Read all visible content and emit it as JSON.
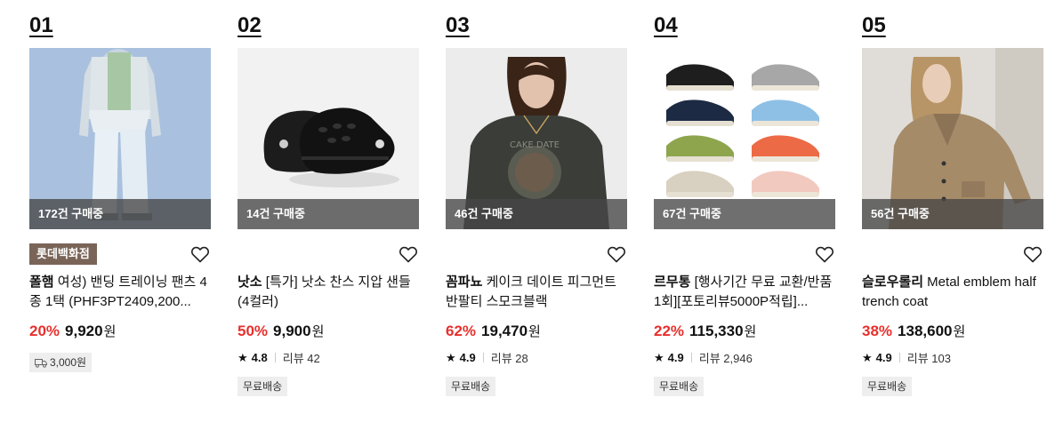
{
  "products": [
    {
      "rank": "01",
      "buying": "172건 구매중",
      "badge": "롯데백화점",
      "brand": "폴햄",
      "name": " 여성) 밴딩 트레이닝 팬츠 4종 1택 (PHF3PT2409,200...",
      "discount": "20%",
      "price": "9,920",
      "won": "원",
      "shipping_fee": "3,000원"
    },
    {
      "rank": "02",
      "buying": "14건 구매중",
      "brand": "낫소",
      "name": " [특가] 낫소 찬스 지압 샌들(4컬러)",
      "discount": "50%",
      "price": "9,900",
      "won": "원",
      "rating": "4.8",
      "reviews": "리뷰 42",
      "free_shipping": "무료배송"
    },
    {
      "rank": "03",
      "buying": "46건 구매중",
      "brand": "꼼파뇨",
      "name": " 케이크 데이트 피그먼트 반팔티 스모크블랙",
      "discount": "62%",
      "price": "19,470",
      "won": "원",
      "rating": "4.9",
      "reviews": "리뷰 28",
      "free_shipping": "무료배송"
    },
    {
      "rank": "04",
      "buying": "67건 구매중",
      "brand": "르무통",
      "name": " [행사기간 무료 교환/반품 1회][포토리뷰5000P적립]...",
      "discount": "22%",
      "price": "115,330",
      "won": "원",
      "rating": "4.9",
      "reviews": "리뷰 2,946",
      "free_shipping": "무료배송"
    },
    {
      "rank": "05",
      "buying": "56건 구매중",
      "brand": "슬로우롤리",
      "name": " Metal emblem half trench coat",
      "discount": "38%",
      "price": "138,600",
      "won": "원",
      "rating": "4.9",
      "reviews": "리뷰 103",
      "free_shipping": "무료배송"
    }
  ],
  "icons": {
    "wishlist": "heart-outline-icon",
    "rating": "star-icon",
    "shipping": "truck-icon"
  },
  "colors": {
    "discount": "#e8302c",
    "badge_bg": "#7a6458",
    "buying_overlay": "#464646"
  }
}
